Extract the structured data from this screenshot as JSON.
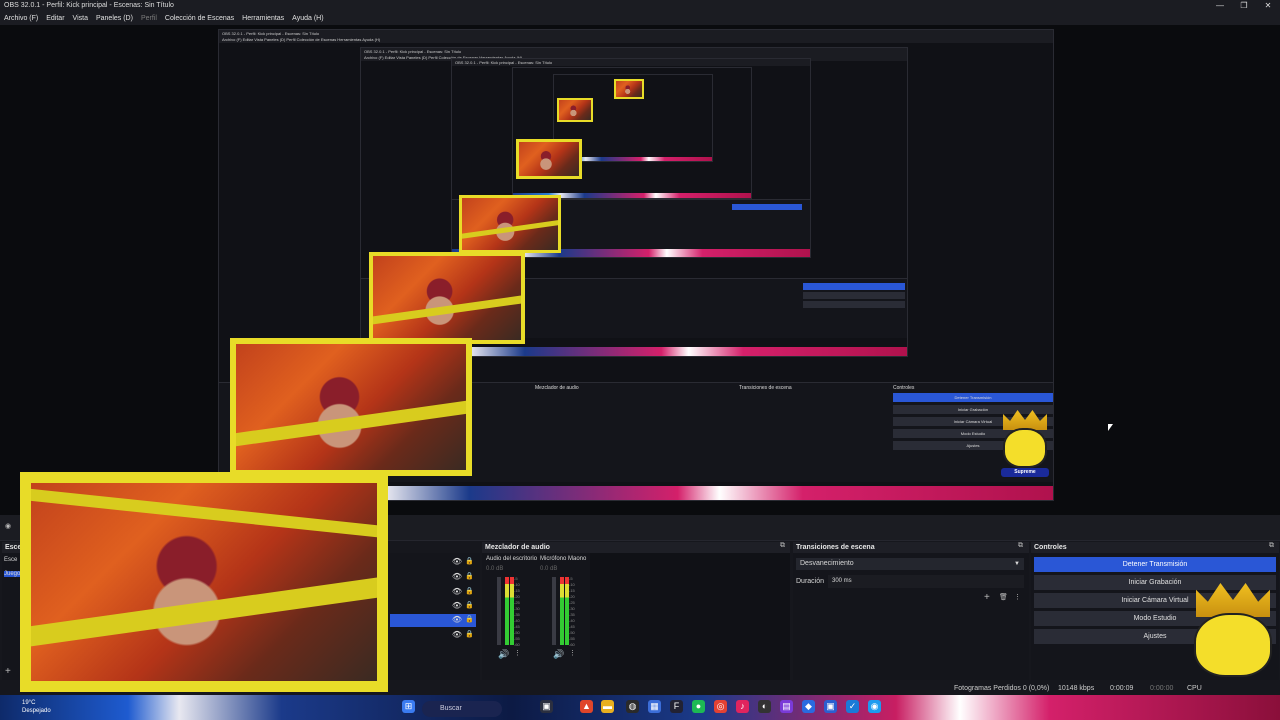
{
  "window": {
    "title": "OBS 32.0.1 - Perfil: Kick principal - Escenas: Sin Título",
    "controls": [
      "—",
      "❐",
      "✕"
    ]
  },
  "menu": [
    "Archivo (F)",
    "Editar",
    "Vista",
    "Paneles (D)",
    "Perfil",
    "Colección de Escenas",
    "Herramientas",
    "Ayuda (H)"
  ],
  "nested": {
    "title": "OBS 32.0.1 - Perfil: Kick principal - Escenas: Sin Título",
    "menu": "Archivo (F)   Editar   Vista   Paneles (D)   Perfil   Colección de Escenas   Herramientas   Ayuda (H)",
    "scenes_abbrev": "Esce",
    "scene_item": "Juego"
  },
  "docks": {
    "scenes_title": "Esce",
    "scene_items": [
      "Esce",
      "Juego"
    ],
    "mixer": {
      "title": "Mezclador de audio",
      "channels": [
        {
          "name": "Audio del escritorio",
          "db": "0.0 dB"
        },
        {
          "name": "Micrófono Maono",
          "db": "0.0 dB"
        }
      ],
      "ticks": [
        "-5",
        "-10",
        "-15",
        "-20",
        "-25",
        "-30",
        "-35",
        "-40",
        "-45",
        "-50",
        "-55",
        "-60"
      ]
    },
    "transitions": {
      "title": "Transiciones de escena",
      "selected": "Desvanecimiento",
      "duration_label": "Duración",
      "duration_value": "300 ms"
    },
    "controls": {
      "title": "Controles",
      "buttons": [
        "Detener Transmisión",
        "Iniciar Grabación",
        "Iniciar Cámara Virtual",
        "Modo Estudio",
        "Ajustes"
      ]
    }
  },
  "status": {
    "dropped": "Fotogramas Perdidos 0 (0,0%)",
    "bitrate": "10148 kbps",
    "live_time": "0:00:09",
    "rec_time": "0:00:00",
    "cpu": "CPU"
  },
  "taskbar": {
    "weather_temp": "19°C",
    "weather_desc": "Despejado",
    "search_placeholder": "Buscar"
  },
  "mascot": {
    "badge": "Supreme"
  },
  "colors": {
    "accent": "#2a57d6",
    "cam_border": "#e8dc28",
    "bg": "#0d0e12"
  }
}
